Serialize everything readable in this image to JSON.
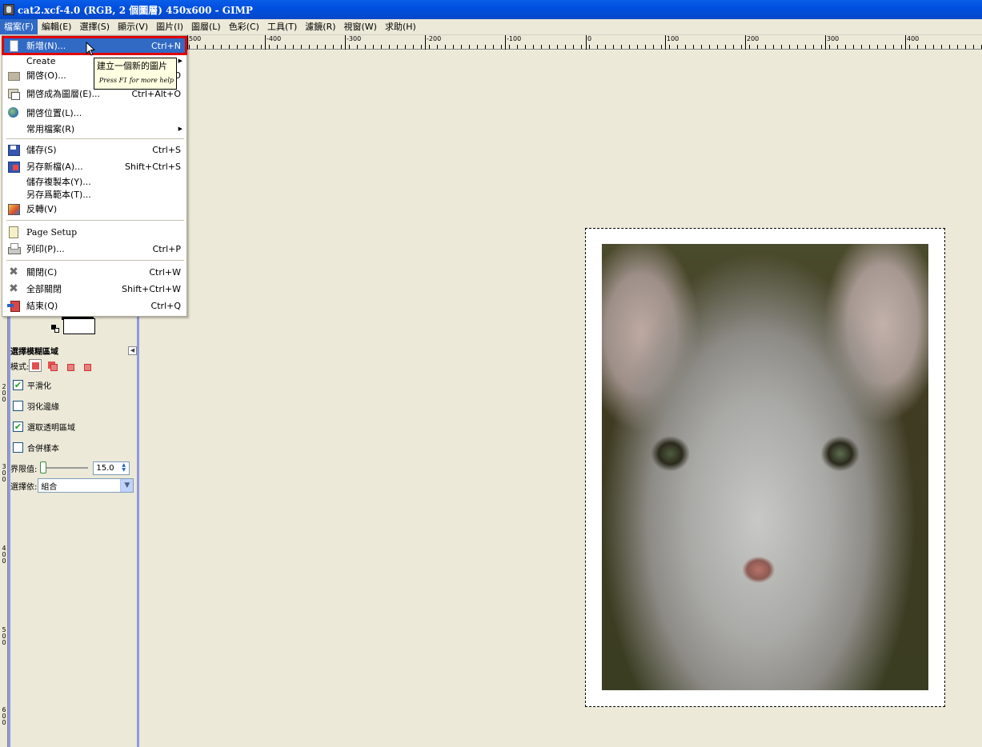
{
  "window": {
    "title": "cat2.xcf-4.0 (RGB, 2 個圖層) 450x600  -  GIMP"
  },
  "menubar": {
    "items": [
      "檔案(F)",
      "編輯(E)",
      "選擇(S)",
      "顯示(V)",
      "圖片(I)",
      "圖層(L)",
      "色彩(C)",
      "工具(T)",
      "濾鏡(R)",
      "視窗(W)",
      "求助(H)"
    ]
  },
  "file_menu": {
    "items": [
      {
        "label": "新增(N)...",
        "shortcut": "Ctrl+N",
        "icon": "new-document-icon",
        "highlighted": true
      },
      {
        "label": "Create",
        "shortcut": "",
        "icon": "",
        "submenu": true
      },
      {
        "label": "開啓(O)...",
        "shortcut": "O",
        "icon": "open-folder-icon"
      },
      {
        "label": "開啓成為圖層(E)...",
        "shortcut": "Ctrl+Alt+O",
        "icon": "open-as-layer-icon"
      },
      {
        "label": "開啓位置(L)...",
        "shortcut": "",
        "icon": "globe-icon"
      },
      {
        "label": "常用檔案(R)",
        "shortcut": "",
        "icon": "",
        "submenu": true
      },
      {
        "label": "儲存(S)",
        "shortcut": "Ctrl+S",
        "icon": "save-icon"
      },
      {
        "label": "另存新檔(A)...",
        "shortcut": "Shift+Ctrl+S",
        "icon": "save-as-icon"
      },
      {
        "label": "儲存複製本(Y)...",
        "shortcut": "",
        "icon": ""
      },
      {
        "label": "另存爲範本(T)...",
        "shortcut": "",
        "icon": ""
      },
      {
        "label": "反轉(V)",
        "shortcut": "",
        "icon": "revert-icon"
      },
      {
        "label": "Page Setup",
        "shortcut": "",
        "icon": "page-setup-icon"
      },
      {
        "label": "列印(P)...",
        "shortcut": "Ctrl+P",
        "icon": "print-icon"
      },
      {
        "label": "關閉(C)",
        "shortcut": "Ctrl+W",
        "icon": "close-icon"
      },
      {
        "label": "全部關閉",
        "shortcut": "Shift+Ctrl+W",
        "icon": "close-all-icon"
      },
      {
        "label": "結束(Q)",
        "shortcut": "Ctrl+Q",
        "icon": "quit-icon"
      }
    ]
  },
  "tooltip": {
    "text": "建立一個新的圖片",
    "hint": "Press F1 for more help"
  },
  "tool_options": {
    "title": "選擇模糊區域",
    "mode_label": "模式:",
    "antialias_label": "平滑化",
    "antialias_checked": true,
    "feather_label": "羽化邊緣",
    "feather_checked": false,
    "transparent_label": "選取透明區域",
    "transparent_checked": true,
    "sample_merged_label": "合併樣本",
    "sample_merged_checked": false,
    "threshold_label": "界限值:",
    "threshold_value": "15.0",
    "select_by_label": "選擇依:",
    "select_by_value": "組合"
  },
  "rulers": {
    "horizontal_ticks": [
      "500",
      "-400",
      "-300",
      "-200",
      "-100",
      "0",
      "100",
      "200",
      "300",
      "400"
    ],
    "vertical_ticks": [
      {
        "label": "2 0 0"
      },
      {
        "label": "3 0 0"
      },
      {
        "label": "4 0 0"
      },
      {
        "label": "5 0 0"
      },
      {
        "label": "6 0 0"
      }
    ]
  },
  "colors": {
    "titlebar": "#0050e0",
    "menu_highlight": "#316ac5",
    "annotation_box": "#e00000",
    "toolbox_frame": "#8f98e0"
  }
}
